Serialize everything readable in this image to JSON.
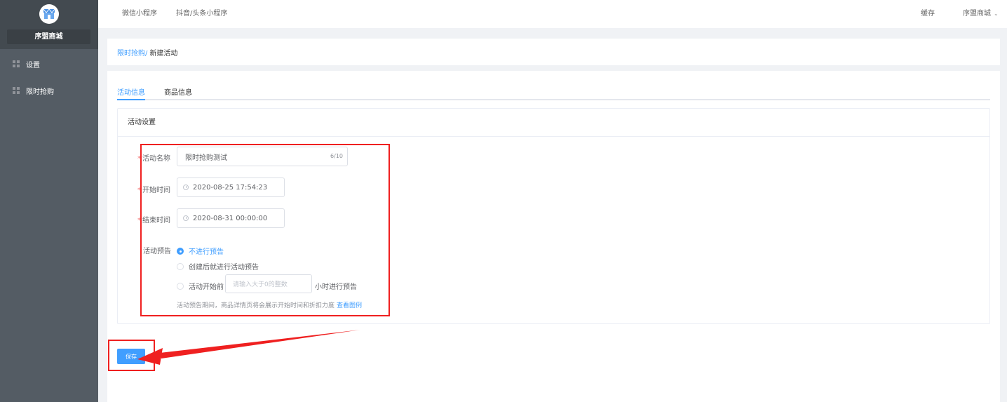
{
  "sidebar": {
    "shop_name": "序盟商城",
    "items": [
      {
        "label": "设置"
      },
      {
        "label": "限时抢购"
      }
    ]
  },
  "topbar": {
    "tabs": [
      {
        "label": "微信小程序"
      },
      {
        "label": "抖音/头条小程序"
      }
    ],
    "cache_label": "缓存",
    "user_label": "序盟商城"
  },
  "breadcrumb": {
    "parent": "限时抢购/",
    "current": "新建活动"
  },
  "tabs": [
    {
      "label": "活动信息",
      "active": true
    },
    {
      "label": "商品信息",
      "active": false
    }
  ],
  "panel": {
    "title": "活动设置",
    "name_label": "活动名称",
    "name_value": "限时抢购测试",
    "name_counter": "6/10",
    "start_label": "开始时间",
    "start_value": "2020-08-25 17:54:23",
    "end_label": "结束时间",
    "end_value": "2020-08-31 00:00:00",
    "preview_label": "活动预告",
    "preview_options": [
      {
        "label": "不进行预告",
        "checked": true
      },
      {
        "label": "创建后就进行活动预告",
        "checked": false
      },
      {
        "label": "活动开始前",
        "checked": false
      }
    ],
    "hours_placeholder": "请输入大于0的整数",
    "hours_suffix": "小时进行预告",
    "hint_text": "活动预告期间，商品详情页将会展示开始时间和折扣力度",
    "hint_link": "查看图例"
  },
  "save_label": "保存",
  "colors": {
    "sidebar": "#545c64",
    "accent": "#409eff",
    "annotation": "#ef2020"
  }
}
